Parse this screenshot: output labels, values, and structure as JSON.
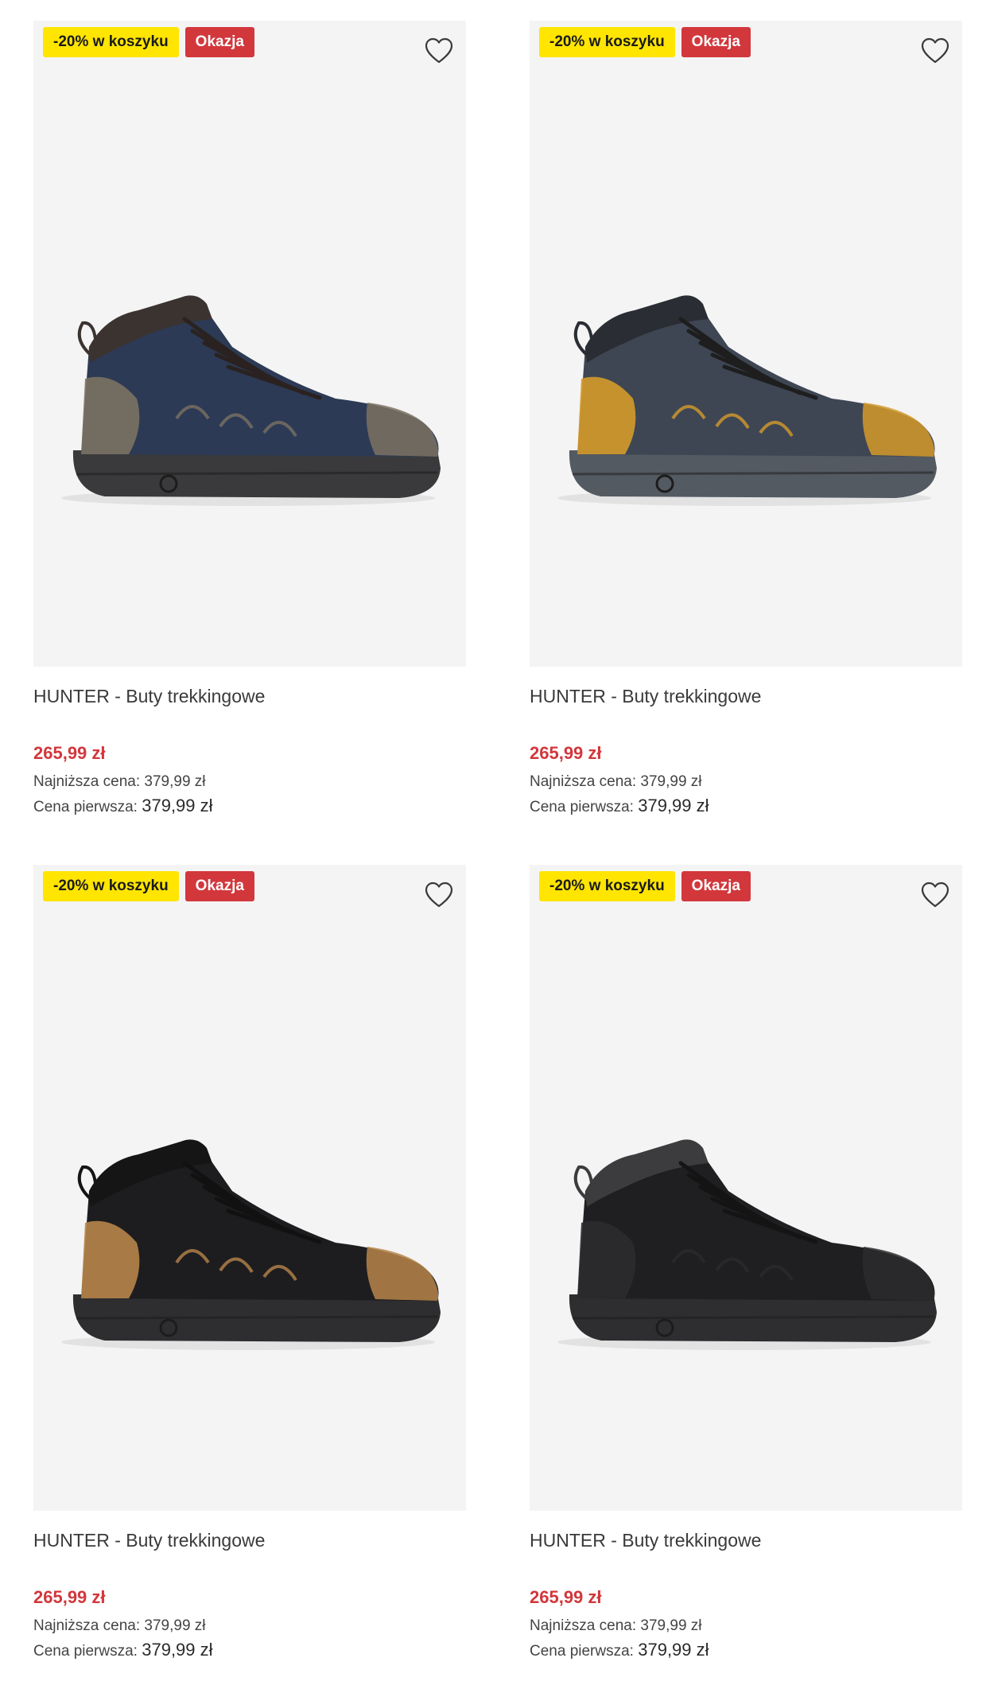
{
  "products": [
    {
      "badge_discount": "-20% w koszyku",
      "badge_deal": "Okazja",
      "wishlist_icon": "heart-outline-icon",
      "title": "HUNTER - Buty trekkingowe",
      "price": "265,99 zł",
      "lowest_price_label": "Najniższa cena:",
      "lowest_price_value": "379,99 zł",
      "first_price_label": "Cena pierwsza:",
      "first_price_value": "379,99 zł",
      "colors": {
        "upper": "#2c3a55",
        "accent": "#7b7262",
        "sole": "#3a3a3c",
        "collar": "#3b3330",
        "lace": "#2a2220"
      }
    },
    {
      "badge_discount": "-20% w koszyku",
      "badge_deal": "Okazja",
      "wishlist_icon": "heart-outline-icon",
      "title": "HUNTER - Buty trekkingowe",
      "price": "265,99 zł",
      "lowest_price_label": "Najniższa cena:",
      "lowest_price_value": "379,99 zł",
      "first_price_label": "Cena pierwsza:",
      "first_price_value": "379,99 zł",
      "colors": {
        "upper": "#3e4654",
        "accent": "#d49a2a",
        "sole": "#545a62",
        "collar": "#2a2d33",
        "lace": "#1e1e1e"
      }
    },
    {
      "badge_discount": "-20% w koszyku",
      "badge_deal": "Okazja",
      "wishlist_icon": "heart-outline-icon",
      "title": "HUNTER - Buty trekkingowe",
      "price": "265,99 zł",
      "lowest_price_label": "Najniższa cena:",
      "lowest_price_value": "379,99 zł",
      "first_price_label": "Cena pierwsza:",
      "first_price_value": "379,99 zł",
      "colors": {
        "upper": "#1d1d1f",
        "accent": "#b7854a",
        "sole": "#2e2e30",
        "collar": "#151515",
        "lace": "#111111"
      }
    },
    {
      "badge_discount": "-20% w koszyku",
      "badge_deal": "Okazja",
      "wishlist_icon": "heart-outline-icon",
      "title": "HUNTER - Buty trekkingowe",
      "price": "265,99 zł",
      "lowest_price_label": "Najniższa cena:",
      "lowest_price_value": "379,99 zł",
      "first_price_label": "Cena pierwsza:",
      "first_price_value": "379,99 zł",
      "colors": {
        "upper": "#1f1f21",
        "accent": "#2b2b2d",
        "sole": "#2e2e30",
        "collar": "#3c3c3e",
        "lace": "#141414"
      }
    }
  ]
}
